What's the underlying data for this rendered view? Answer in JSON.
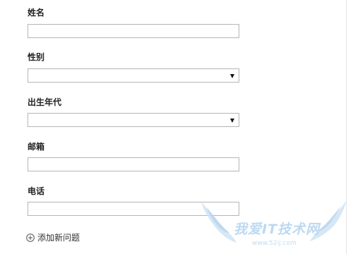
{
  "form": {
    "fields": [
      {
        "key": "name",
        "label": "姓名",
        "type": "text",
        "value": ""
      },
      {
        "key": "gender",
        "label": "性别",
        "type": "select",
        "value": ""
      },
      {
        "key": "birth_era",
        "label": "出生年代",
        "type": "select",
        "value": ""
      },
      {
        "key": "email",
        "label": "邮箱",
        "type": "text",
        "value": ""
      },
      {
        "key": "phone",
        "label": "电话",
        "type": "text",
        "value": ""
      }
    ],
    "add_question_label": "添加新问题",
    "add_question_icon": "plus-circle-icon"
  },
  "watermark": {
    "text": "我爱IT技术网",
    "url": "www.52ij.com",
    "color": "#bcd9f2"
  },
  "colors": {
    "border": "#b5b5b5",
    "label_text": "#222222",
    "background": "#ffffff"
  }
}
